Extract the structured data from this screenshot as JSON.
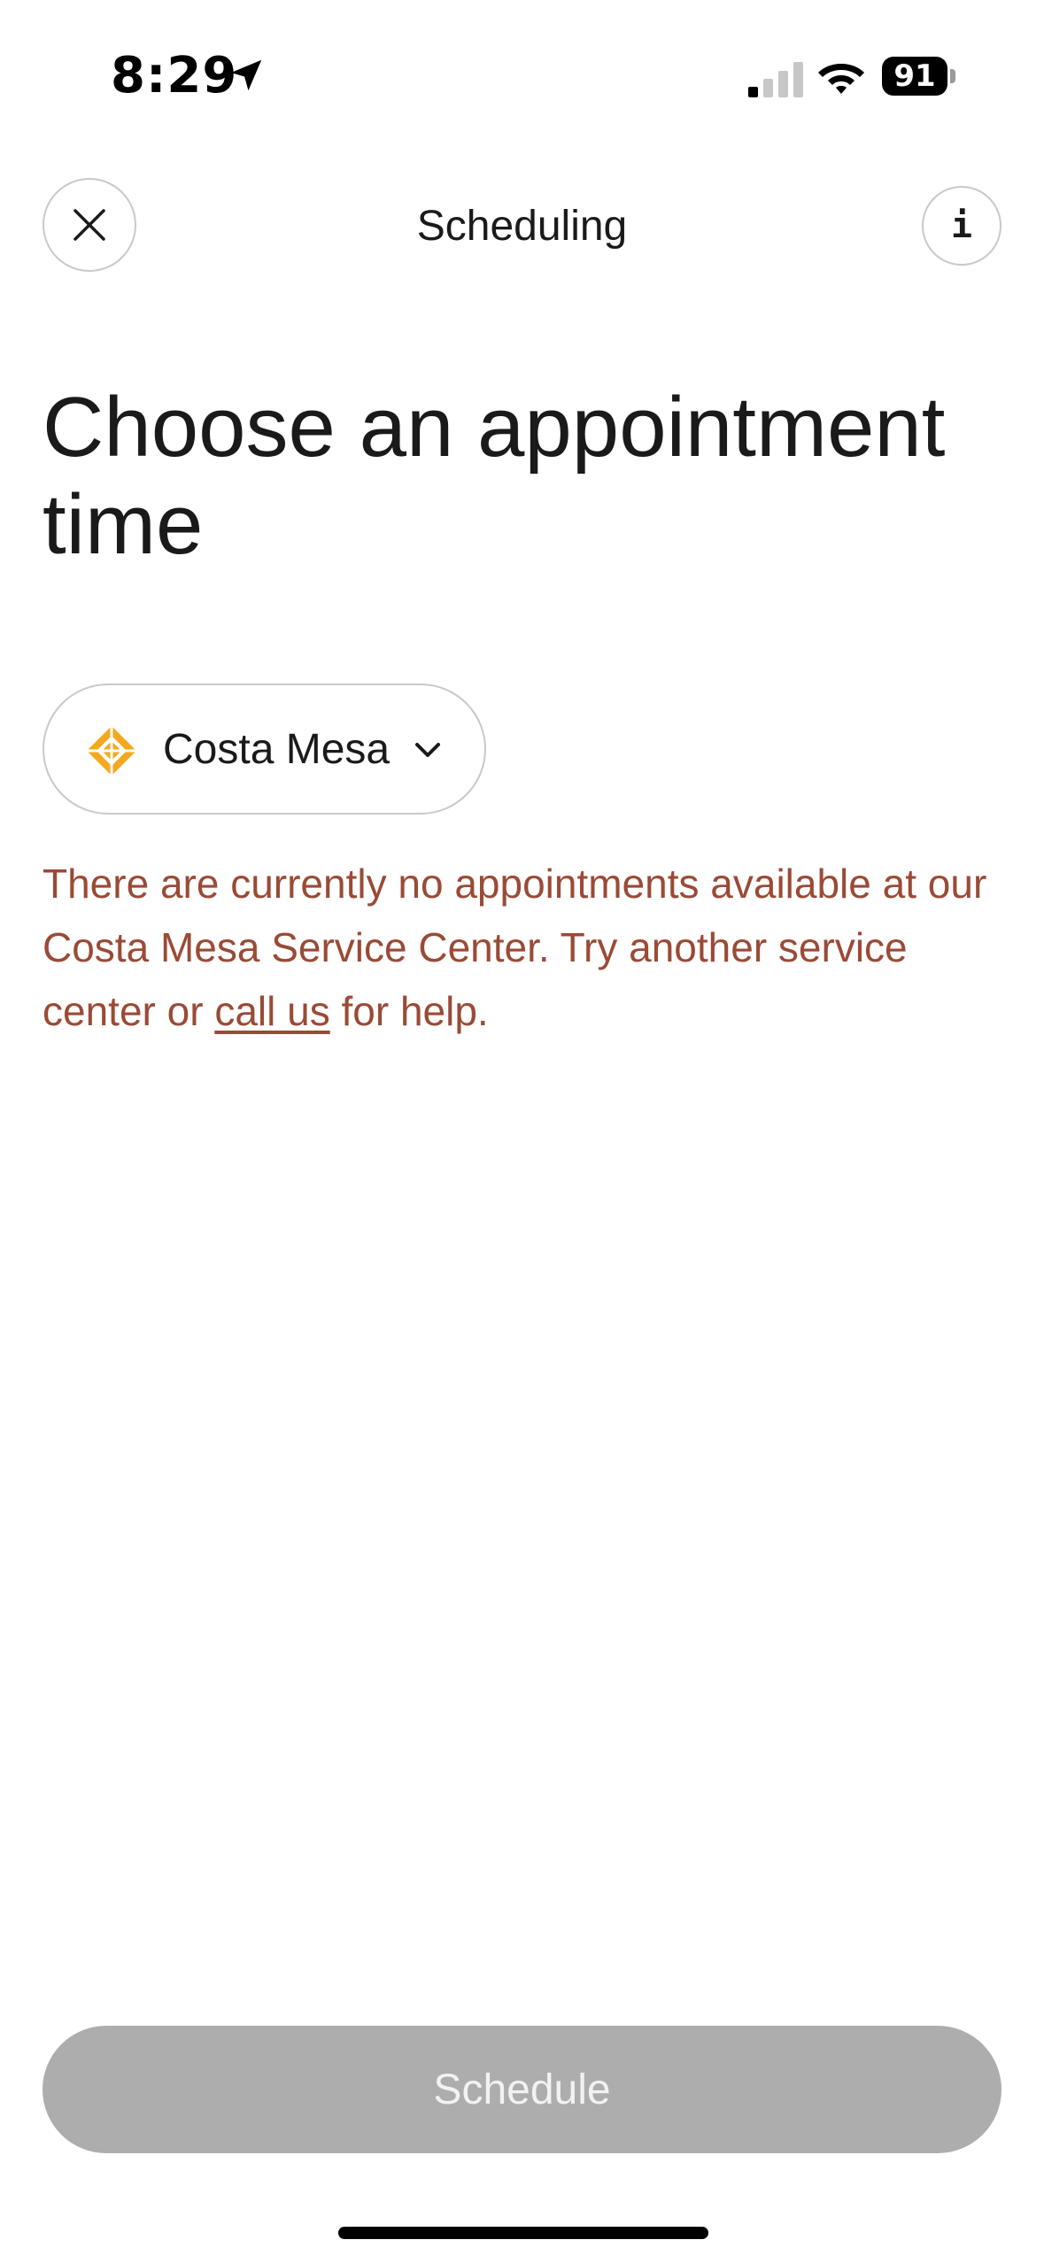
{
  "status_bar": {
    "time": "8:29",
    "battery_percent": "91",
    "signal_bars_active": 1,
    "signal_bars_total": 4,
    "icons": [
      "location-arrow-icon",
      "signal-icon",
      "wifi-icon",
      "battery-icon"
    ]
  },
  "header": {
    "title": "Scheduling",
    "close_icon": "close-icon",
    "info_glyph": "i"
  },
  "main": {
    "title": "Choose an appointment time",
    "location_selector": {
      "label": "Costa Mesa",
      "icon": "service-center-icon",
      "chevron": "chevron-down-icon"
    },
    "error": {
      "text_before_link": "There are currently no appointments available at our Costa Mesa Service Center. Try another service center or ",
      "link_text": "call us",
      "text_after_link": " for help."
    }
  },
  "footer": {
    "schedule_label": "Schedule"
  },
  "colors": {
    "error_text": "#9a4a36",
    "disabled_button": "#adadad",
    "service_icon": "#f4a81d",
    "border": "#c9c9c9"
  }
}
